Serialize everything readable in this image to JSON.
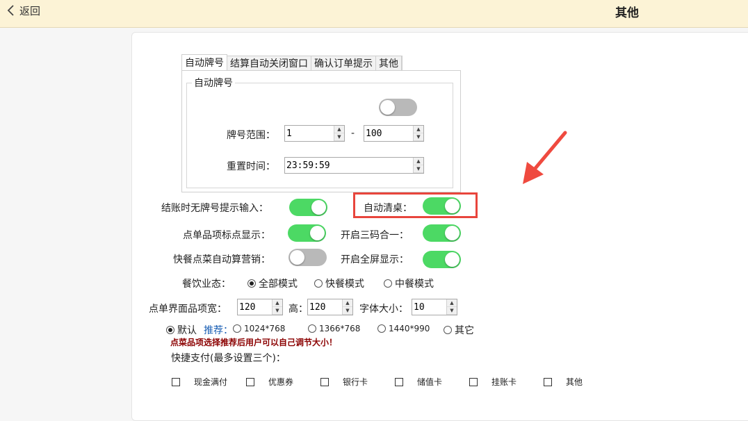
{
  "header": {
    "back_label": "返回",
    "title": "其他"
  },
  "tabs": [
    "自动牌号",
    "结算自动关闭窗口",
    "确认订单提示",
    "其他"
  ],
  "auto_number": {
    "group_title": "自动牌号",
    "enabled": false,
    "range_label": "牌号范围：",
    "range_from": "1",
    "range_sep": "-",
    "range_to": "100",
    "reset_label": "重置时间：",
    "reset_time": "23:59:59"
  },
  "settings": {
    "no_number_prompt_label": "结账时无牌号提示输入：",
    "no_number_prompt_on": true,
    "auto_clear_label": "自动清桌：",
    "auto_clear_on": true,
    "dot_display_label": "点单品项标点显示：",
    "dot_display_on": true,
    "three_code_label": "开启三码合一：",
    "three_code_on": true,
    "fast_marketing_label": "快餐点菜自动算营销：",
    "fast_marketing_on": false,
    "fullscreen_label": "开启全屏显示：",
    "fullscreen_on": true
  },
  "mode": {
    "label": "餐饮业态：",
    "options": [
      "全部模式",
      "快餐模式",
      "中餐模式"
    ],
    "selected": "全部模式"
  },
  "item_size": {
    "width_label": "点单界面品项宽：",
    "width_value": "120",
    "height_label": "高：",
    "height_value": "120",
    "font_label": "字体大小：",
    "font_value": "10"
  },
  "resolution": {
    "default_label": "默认",
    "recommend_label": "推荐：",
    "options": [
      "1024*768",
      "1366*768",
      "1440*990",
      "其它"
    ],
    "selected": "默认"
  },
  "warning_text": "点菜品项选择推荐后用户可以自己调节大小！",
  "quick_pay": {
    "label": "快捷支付(最多设置三个)：",
    "options": [
      "现金满付",
      "优惠券",
      "银行卡",
      "储值卡",
      "挂账卡",
      "其他"
    ]
  },
  "colors": {
    "toggle_on": "#4cd964",
    "toggle_off": "#b9b9b9",
    "highlight": "#e8453c",
    "warning": "#8b0000",
    "recommend": "#1a5fb4"
  },
  "icons": {
    "back": "chevron-left-icon",
    "annotation": "red-arrow-icon"
  }
}
